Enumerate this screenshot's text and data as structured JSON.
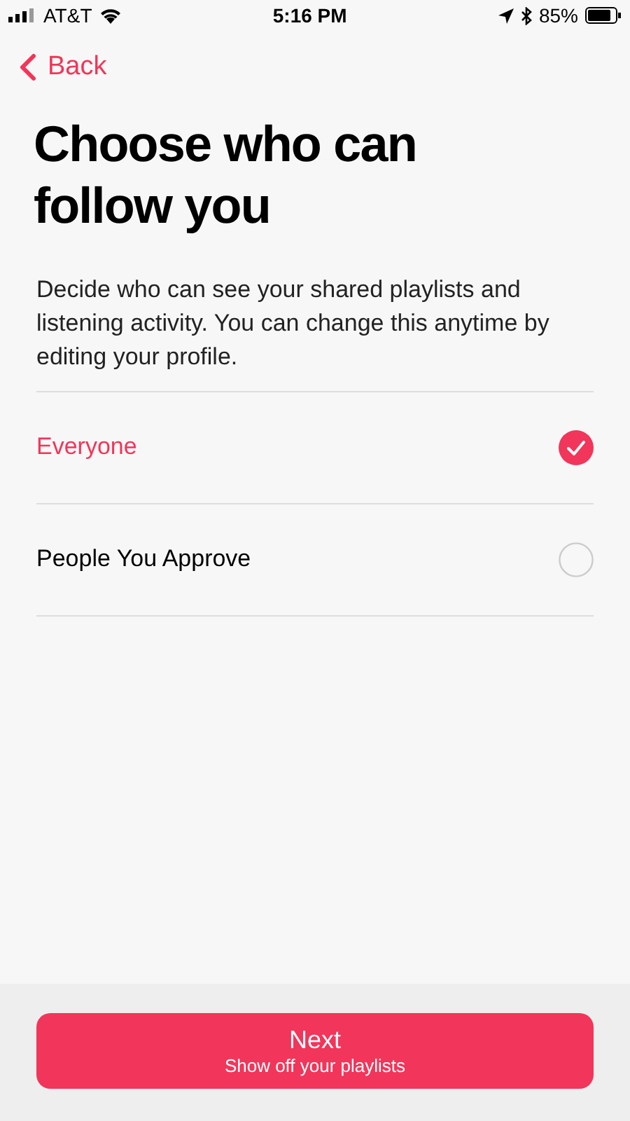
{
  "status_bar": {
    "carrier": "AT&T",
    "time": "5:16 PM",
    "battery": "85%"
  },
  "nav": {
    "back": "Back"
  },
  "title": "Choose who can follow you",
  "description": "Decide who can see your shared playlists and listening activity. You can change this anytime by editing your profile.",
  "options": [
    {
      "label": "Everyone",
      "selected": true
    },
    {
      "label": "People You Approve",
      "selected": false
    }
  ],
  "next_button": {
    "label": "Next",
    "sublabel": "Show off your playlists"
  }
}
